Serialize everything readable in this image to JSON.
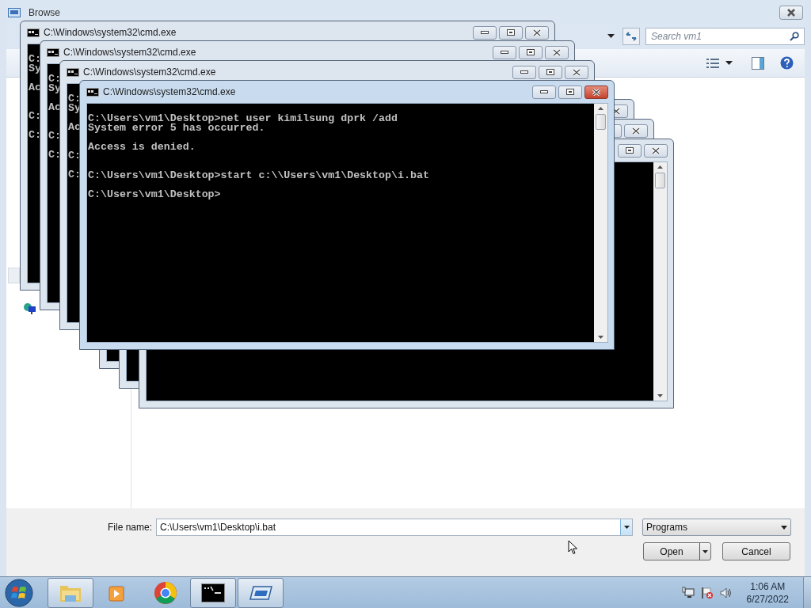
{
  "dialog": {
    "title": "Browse",
    "search": {
      "placeholder": "Search vm1"
    },
    "file_name": {
      "label": "File name:",
      "value": "C:\\Users\\vm1\\Desktop\\i.bat"
    },
    "file_type": {
      "value": "Programs"
    },
    "buttons": [
      {
        "label": "Open",
        "kind": "split"
      },
      {
        "label": "Cancel",
        "kind": "plain"
      }
    ]
  },
  "console_windows": [
    {
      "title": "C:\\Windows\\system32\\cmd.exe",
      "text": "C:\nSy\n\nAc\n\n\nC:\n\nC:",
      "active": false
    },
    {
      "title": "C:\\Windows\\system32\\cmd.exe",
      "text": "C:\nSy\n\nAc\n\n\nC:\n\nC:",
      "active": false
    },
    {
      "title": "C:\\Windows\\system32\\cmd.exe",
      "text": "C:\nSy\n\nAc\n\n\nC:\n\nC:",
      "active": false
    },
    {
      "active": false
    },
    {
      "active": false
    },
    {
      "active": false
    },
    {
      "title": "C:\\Windows\\system32\\cmd.exe",
      "text": "C:\\Users\\vm1\\Desktop>net user kimilsung dprk /add\nSystem error 5 has occurred.\n\nAccess is denied.\n\n\nC:\\Users\\vm1\\Desktop>start c:\\\\Users\\vm1\\Desktop\\i.bat\n\nC:\\Users\\vm1\\Desktop>",
      "active": true
    }
  ],
  "taskbar": {
    "buttons": [
      {
        "kind": "folder",
        "open": true
      },
      {
        "kind": "media",
        "open": false
      },
      {
        "kind": "browser",
        "open": false
      },
      {
        "kind": "console",
        "open": true
      },
      {
        "kind": "window",
        "open": true
      }
    ],
    "clock": {
      "time": "1:06 AM",
      "date": "6/27/2022"
    }
  }
}
